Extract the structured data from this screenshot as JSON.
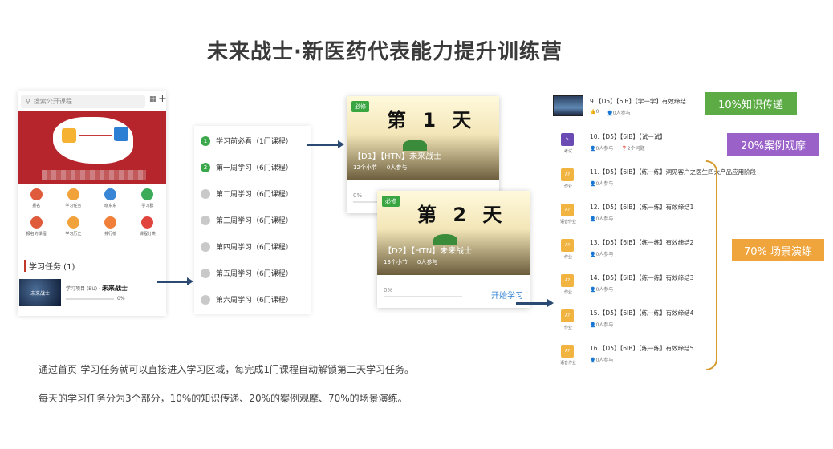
{
  "title": "未来战士·新医药代表能力提升训练营",
  "phone": {
    "search_placeholder": "搜索公开课程",
    "banner_text": "闻东东",
    "grid": [
      {
        "label": "报名",
        "color": "#e05a3c"
      },
      {
        "label": "学习任务",
        "color": "#f2a23a"
      },
      {
        "label": "晓东东",
        "color": "#3a86d6"
      },
      {
        "label": "学习群",
        "color": "#3bab5a"
      },
      {
        "label": "报名的课程",
        "color": "#e05a3c"
      },
      {
        "label": "学习历史",
        "color": "#f2a23a"
      },
      {
        "label": "排行榜",
        "color": "#f07f3a"
      },
      {
        "label": "课程分类",
        "color": "#e0443c"
      }
    ],
    "tasks_header": "学习任务 (1)",
    "task": {
      "thumb_text": "未来战士",
      "tag": "学习项目",
      "code": "(BU)",
      "name": "未来战士",
      "progress": "0%"
    }
  },
  "weeks": [
    {
      "num": "1",
      "label": "学习前必看（1门课程）",
      "active": true
    },
    {
      "num": "2",
      "label": "第一周学习（6门课程）",
      "active": true
    },
    {
      "num": "",
      "label": "第二周学习（6门课程）",
      "active": false
    },
    {
      "num": "",
      "label": "第三周学习（6门课程）",
      "active": false
    },
    {
      "num": "",
      "label": "第四周学习（6门课程）",
      "active": false
    },
    {
      "num": "",
      "label": "第五周学习（6门课程）",
      "active": false
    },
    {
      "num": "",
      "label": "第六周学习（6门课程）",
      "active": false
    }
  ],
  "cards": [
    {
      "tag": "必修",
      "day": "第 1 天",
      "name": "【D1】【HTN】未来战士",
      "sections": "12个小节",
      "participants": "0人参与",
      "progress": "0%",
      "start": ""
    },
    {
      "tag": "必修",
      "day": "第 2 天",
      "name": "【D2】【HTN】未来战士",
      "sections": "13个小节",
      "participants": "0人参与",
      "progress": "0%",
      "start": "开始学习"
    }
  ],
  "lessons": [
    {
      "icon": "thumb",
      "icon_label": "",
      "color": "",
      "title": "9.【D5】【6IB】【学一学】有效缔结",
      "meta1": "0",
      "meta2": "0人参与"
    },
    {
      "icon": "考试",
      "icon_label": "考试",
      "color": "#6a4bb3",
      "title": "10.【D5】【6IB】【试一试】",
      "meta1": "0人参与",
      "meta2": "2个问题"
    },
    {
      "icon": "作业",
      "icon_label": "作业",
      "color": "#f2b440",
      "title": "11.【D5】【6IB】【练一练】洞见客户之医生四大产品应用阶段",
      "meta1": "0人参与",
      "meta2": ""
    },
    {
      "icon": "作业",
      "icon_label": "语音作业",
      "color": "#f2b440",
      "title": "12.【D5】【6IB】【练一练】有效缔结1",
      "meta1": "0人参与",
      "meta2": ""
    },
    {
      "icon": "作业",
      "icon_label": "作业",
      "color": "#f2b440",
      "title": "13.【D5】【6IB】【练一练】有效缔结2",
      "meta1": "0人参与",
      "meta2": ""
    },
    {
      "icon": "作业",
      "icon_label": "作业",
      "color": "#f2b440",
      "title": "14.【D5】【6IB】【练一练】有效缔结3",
      "meta1": "0人参与",
      "meta2": ""
    },
    {
      "icon": "作业",
      "icon_label": "作业",
      "color": "#f2b440",
      "title": "15.【D5】【6IB】【练一练】有效缔结4",
      "meta1": "0人参与",
      "meta2": ""
    },
    {
      "icon": "作业",
      "icon_label": "语音作业",
      "color": "#f2b440",
      "title": "16.【D5】【6IB】【练一练】有效缔结5",
      "meta1": "0人参与",
      "meta2": ""
    }
  ],
  "labels": [
    {
      "text": "10%知识传递",
      "color": "#5cab45"
    },
    {
      "text": "20%案例观摩",
      "color": "#9a62c9"
    },
    {
      "text": "70% 场景演练",
      "color": "#f0a43c"
    }
  ],
  "desc": [
    "通过首页-学习任务就可以直接进入学习区域，每完成1门课程自动解锁第二天学习任务。",
    "每天的学习任务分为3个部分，10%的知识传递、20%的案例观摩、70%的场景演练。"
  ]
}
